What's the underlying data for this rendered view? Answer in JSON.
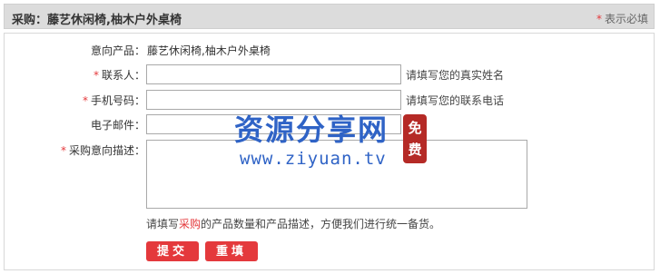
{
  "header": {
    "title": "采购：藤艺休闲椅,柚木户外桌椅",
    "required_star": "*",
    "required_note": "表示必填"
  },
  "form": {
    "product": {
      "label": "意向产品：",
      "value": "藤艺休闲椅,柚木户外桌椅"
    },
    "contact": {
      "star": "*",
      "label": "联系人：",
      "value": "",
      "hint": "请填写您的真实姓名"
    },
    "phone": {
      "star": "*",
      "label": "手机号码：",
      "value": "",
      "hint": "请填写您的联系电话"
    },
    "email": {
      "label": "电子邮件：",
      "value": ""
    },
    "description": {
      "star": "*",
      "label": "采购意向描述：",
      "value": ""
    },
    "desc_hint": {
      "pre": "请填写",
      "highlight": "采购",
      "post": "的产品数量和产品描述，方便我们进行统一备货。"
    }
  },
  "buttons": {
    "submit": "提交",
    "reset": "重填"
  },
  "watermark": {
    "text": "资源分享网",
    "url": "www.ziyuan.tv",
    "seal": "免费"
  },
  "colors": {
    "accent": "#e4393c",
    "header_bg": "#dcdcdc",
    "watermark": "#2f63c6",
    "seal": "#b52a26"
  }
}
